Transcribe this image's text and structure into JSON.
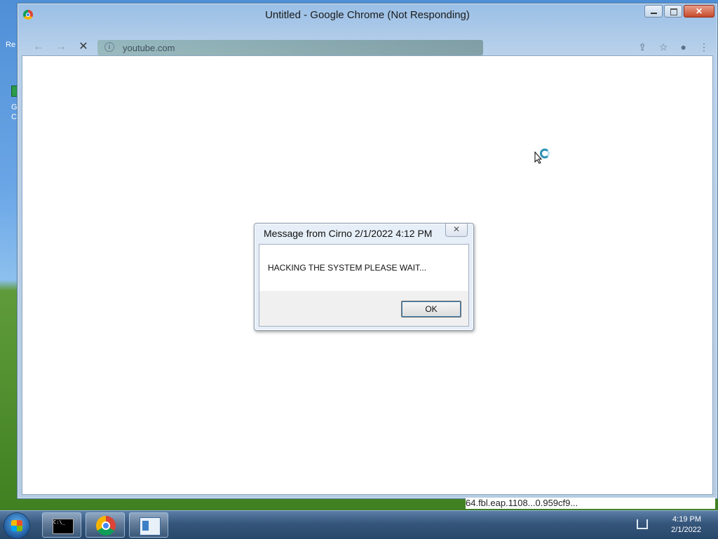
{
  "desktop": {
    "top_label": "Re",
    "icon_label": "G\nC"
  },
  "window": {
    "title": "Untitled - Google Chrome (Not Responding)",
    "controls": {
      "minimize": "",
      "maximize": "",
      "close": "✕"
    }
  },
  "toolbar": {
    "back_icon": "←",
    "forward_icon": "→",
    "stop_icon": "✕",
    "url": "youtube.com",
    "info_icon": "i",
    "share_icon": "⇪",
    "star_icon": "☆",
    "profile_icon": "●",
    "menu_icon": "⋮"
  },
  "dialog": {
    "title": "Message from Cirno 2/1/2022 4:12 PM",
    "close_label": "✕",
    "message": "HACKING THE SYSTEM PLEASE WAIT...",
    "ok_label": "OK"
  },
  "background_text": {
    "cmdline": "64.fbl.eap.1108...0.959cf9..."
  },
  "taskbar": {
    "items": [
      {
        "name": "Command Prompt",
        "icon": "cmd-icon"
      },
      {
        "name": "Google Chrome",
        "icon": "chrome-icon"
      },
      {
        "name": "Document window",
        "icon": "document-icon"
      }
    ],
    "cmd_glyph": "C:\\_",
    "clock_time": "4:19 PM",
    "clock_date": "2/1/2022"
  }
}
